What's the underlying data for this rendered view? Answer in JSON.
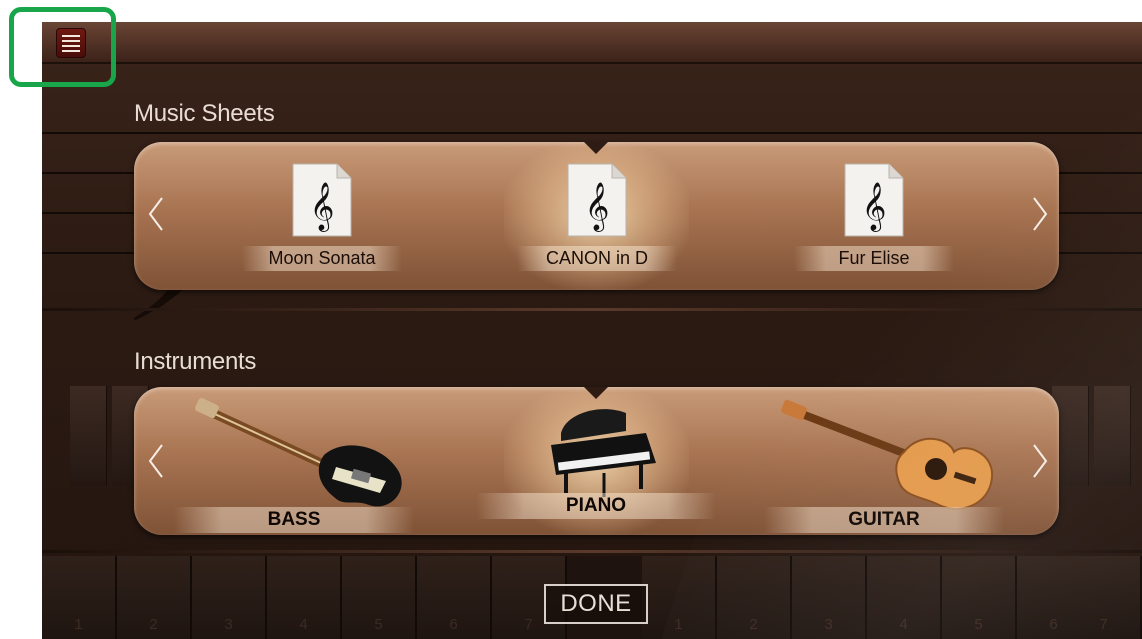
{
  "topbar": {
    "menu_icon": "hamburger-menu-icon",
    "highlight_color": "#19a64a"
  },
  "music_sheets": {
    "title": "Music Sheets",
    "items": [
      {
        "label": "Moon Sonata",
        "icon": "treble-clef-document-icon"
      },
      {
        "label": "CANON in D",
        "icon": "treble-clef-document-icon"
      },
      {
        "label": "Fur Elise",
        "icon": "treble-clef-document-icon"
      }
    ],
    "prev_icon": "chevron-left-icon",
    "next_icon": "chevron-right-icon"
  },
  "instruments": {
    "title": "Instruments",
    "items": [
      {
        "label": "BASS",
        "icon": "bass-guitar-icon"
      },
      {
        "label": "PIANO",
        "icon": "grand-piano-icon"
      },
      {
        "label": "GUITAR",
        "icon": "acoustic-guitar-icon"
      }
    ],
    "prev_icon": "chevron-left-icon",
    "next_icon": "chevron-right-icon"
  },
  "key_numbers": [
    "1",
    "2",
    "3",
    "4",
    "5",
    "6",
    "7",
    "1",
    "2",
    "3",
    "4",
    "5",
    "6",
    "7"
  ],
  "done_label": "DONE",
  "colors": {
    "panel": "#a87452",
    "background": "#2c1b13",
    "menu_button": "#6e1912"
  }
}
